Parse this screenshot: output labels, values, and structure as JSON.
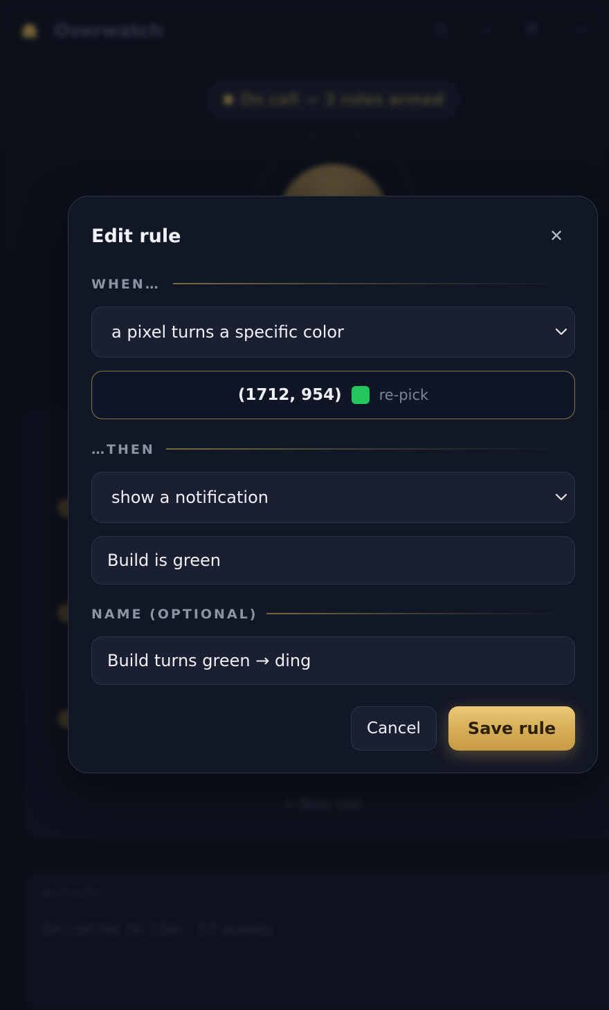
{
  "background": {
    "app_name": "Overwatch",
    "status_pill": "On call — 3 rules armed",
    "add_rule": "+ New rule",
    "activity_label": "ACTIVITY",
    "activity_line": "On call for 1h 23m · 57 events"
  },
  "modal": {
    "title": "Edit rule",
    "close_glyph": "✕",
    "when_label": "WHEN…",
    "trigger_value": "a pixel turns a specific color",
    "picker": {
      "coords": "(1712, 954)",
      "swatch_color": "#22c55e",
      "repick_label": "re-pick"
    },
    "then_label": "…THEN",
    "action_value": "show a notification",
    "message_value": "Build is green",
    "name_label": "NAME (OPTIONAL)",
    "name_value": "Build turns green → ding",
    "cancel_label": "Cancel",
    "save_label": "Save rule"
  },
  "colors": {
    "accent": "#d5ac56",
    "swatch": "#22c55e"
  }
}
